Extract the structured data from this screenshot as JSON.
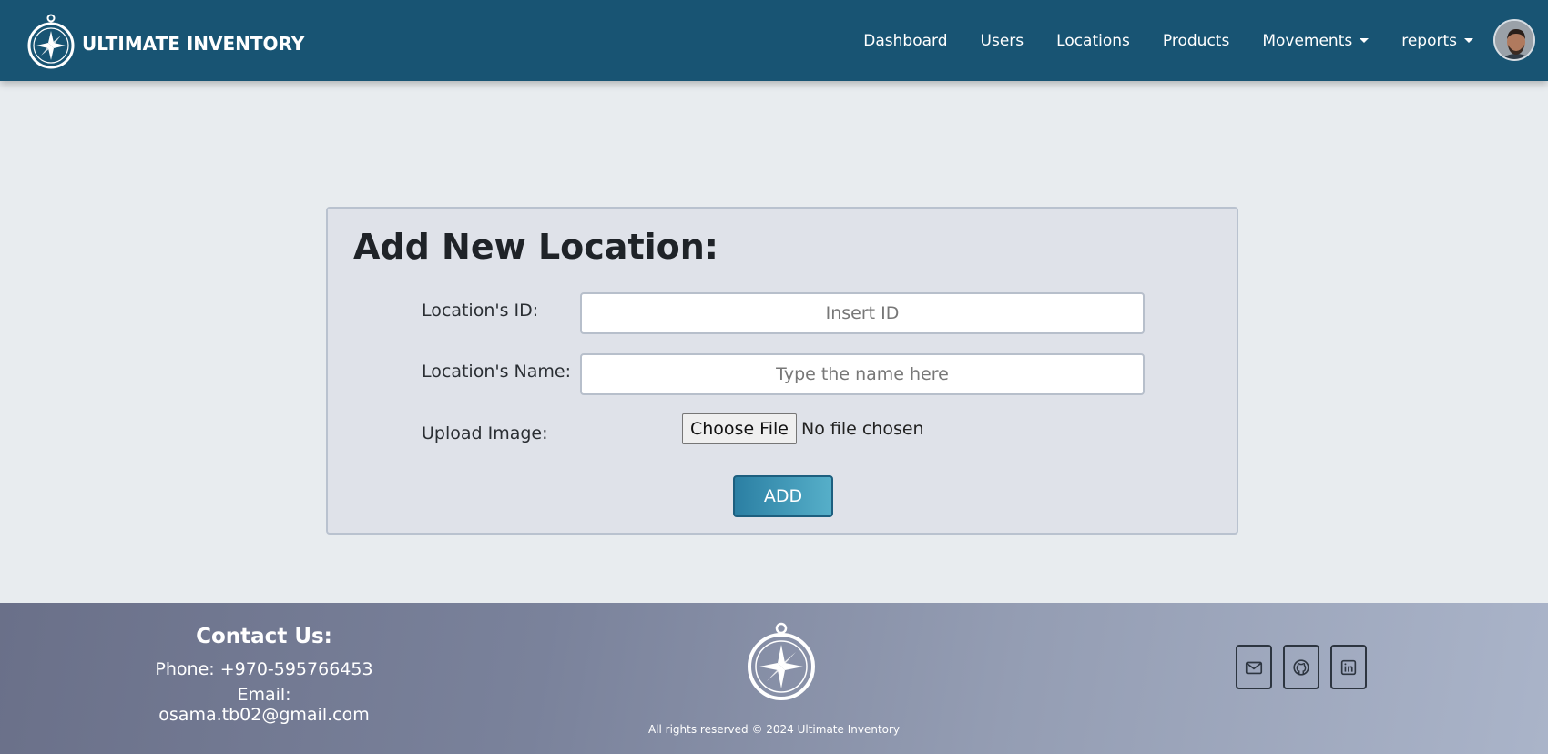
{
  "brand": {
    "name": "ULTIMATE INVENTORY",
    "logo_icon": "compass-icon"
  },
  "nav": {
    "dashboard": "Dashboard",
    "users": "Users",
    "locations": "Locations",
    "products": "Products",
    "movements": "Movements",
    "reports": "reports"
  },
  "form": {
    "title": "Add New Location:",
    "id_label": "Location's ID:",
    "id_placeholder": "Insert ID",
    "id_value": "",
    "name_label": "Location's Name:",
    "name_placeholder": "Type the name here",
    "name_value": "",
    "image_label": "Upload Image:",
    "file_button": "Choose File",
    "file_status": "No file chosen",
    "submit": "ADD"
  },
  "footer": {
    "contact_title": "Contact Us:",
    "phone": "Phone: +970-595766453",
    "email": "Email: osama.tb02@gmail.com",
    "copyright": "All rights reserved © 2024 Ultimate Inventory",
    "socials": [
      "mail-icon",
      "github-icon",
      "linkedin-icon"
    ]
  },
  "colors": {
    "navbar": "#185473",
    "accent_button": "#2b7fa3",
    "page_bg": "#e8ecef",
    "card_bg": "#dfe2e9"
  }
}
